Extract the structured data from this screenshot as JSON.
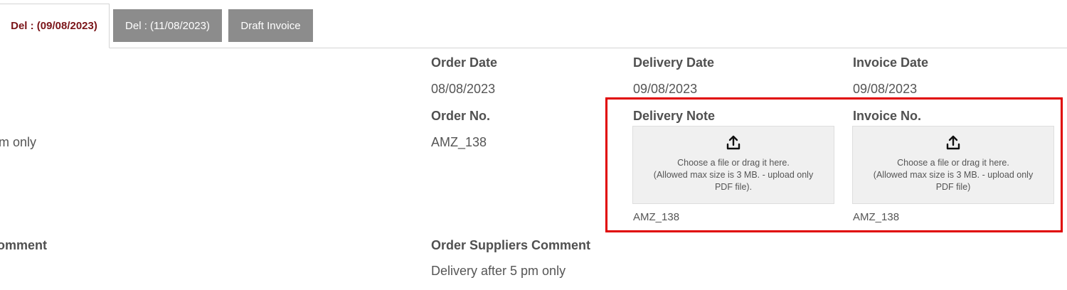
{
  "tabs": [
    {
      "label": "Del : (09/08/2023)",
      "active": true
    },
    {
      "label": "Del : (11/08/2023)",
      "active": false
    },
    {
      "label": "Draft Invoice",
      "active": false
    }
  ],
  "left_partial": {
    "value_text": "m only",
    "comment_label": "omment"
  },
  "order": {
    "date_label": "Order Date",
    "date_value": "08/08/2023",
    "no_label": "Order No.",
    "no_value": "AMZ_138"
  },
  "delivery": {
    "date_label": "Delivery Date",
    "date_value": "09/08/2023",
    "note_label": "Delivery Note",
    "upload_line1": "Choose a file or drag it here.",
    "upload_line2": "(Allowed max size is 3 MB. - upload only PDF file).",
    "file_name": "AMZ_138"
  },
  "invoice": {
    "date_label": "Invoice Date",
    "date_value": "09/08/2023",
    "no_label": "Invoice No.",
    "upload_line1": "Choose a file or drag it here.",
    "upload_line2": "(Allowed max size is 3 MB. - upload only PDF file)",
    "file_name": "AMZ_138"
  },
  "suppliers_comment": {
    "label": "Order Suppliers Comment",
    "value": "Delivery after 5 pm only"
  },
  "icons": {
    "upload": "upload-icon"
  },
  "colors": {
    "active_tab_text": "#7a1418",
    "inactive_tab_bg": "#8c8c8c",
    "highlight_border": "#e00000"
  }
}
